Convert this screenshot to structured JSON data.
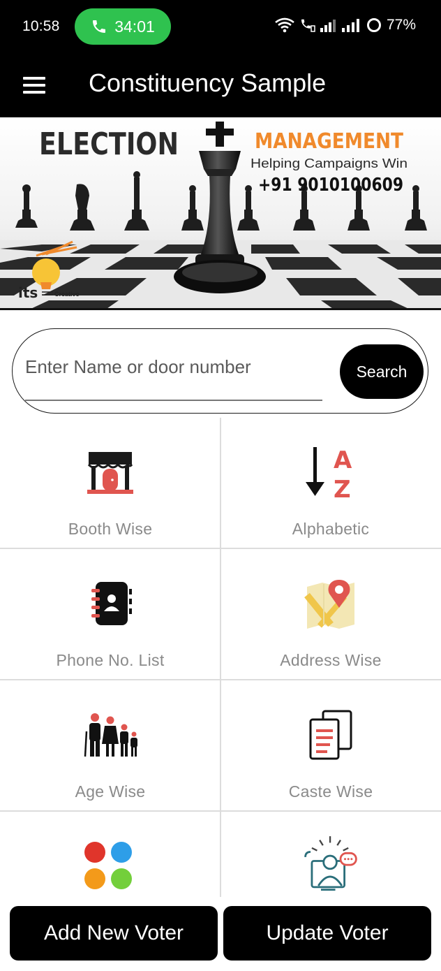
{
  "status_bar": {
    "time": "10:58",
    "call_timer": "34:01",
    "battery": "77%",
    "call_color": "#2fc24f"
  },
  "app_bar": {
    "title": "Constituency Sample",
    "menu_icon": "hamburger-menu-icon"
  },
  "banner": {
    "headline_left": "ELECTION",
    "headline_right": "MANAGEMENT",
    "tagline": "Helping Campaigns Win",
    "phone": "+91 9010100609",
    "logo_text": "its",
    "logo_subtext": "Creative",
    "accent_color": "#f08a2c"
  },
  "search": {
    "placeholder": "Enter Name or door number",
    "value": "",
    "button_label": "Search"
  },
  "grid": {
    "tiles": [
      {
        "label": "Booth Wise",
        "icon": "booth-icon"
      },
      {
        "label": "Alphabetic",
        "icon": "sort-alphabetic-icon"
      },
      {
        "label": "Phone No. List",
        "icon": "contact-book-icon"
      },
      {
        "label": "Address Wise",
        "icon": "map-pin-icon"
      },
      {
        "label": "Age Wise",
        "icon": "family-icon"
      },
      {
        "label": "Caste Wise",
        "icon": "documents-icon"
      },
      {
        "label": "",
        "icon": "colored-dots-icon"
      },
      {
        "label": "",
        "icon": "user-chat-icon"
      }
    ]
  },
  "actions": {
    "add_label": "Add New Voter",
    "update_label": "Update Voter"
  }
}
